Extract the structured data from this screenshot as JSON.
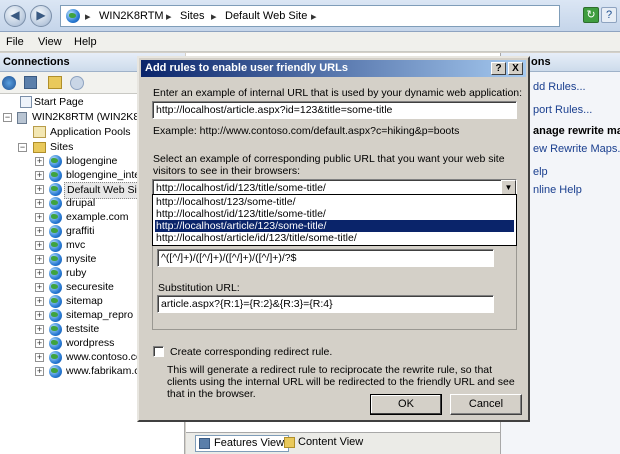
{
  "address": {
    "crumbs": [
      "WIN2K8RTM",
      "Sites",
      "Default Web Site"
    ]
  },
  "menu": [
    "File",
    "View",
    "Help"
  ],
  "connections": {
    "title": "Connections",
    "tree": [
      {
        "label": "Start Page",
        "icon": "start-page-icon"
      },
      {
        "label": "WIN2K8RTM (WIN2K8RTM",
        "icon": "server-icon"
      },
      {
        "label": "Application Pools",
        "icon": "app-pools-icon"
      },
      {
        "label": "Sites",
        "icon": "folder-icon"
      },
      {
        "label": "blogengine",
        "icon": "site-icon"
      },
      {
        "label": "blogengine_integ",
        "icon": "site-icon"
      },
      {
        "label": "Default Web Site",
        "icon": "site-icon"
      },
      {
        "label": "drupal",
        "icon": "site-icon"
      },
      {
        "label": "example.com",
        "icon": "site-icon"
      },
      {
        "label": "graffiti",
        "icon": "site-icon"
      },
      {
        "label": "mvc",
        "icon": "site-icon"
      },
      {
        "label": "mysite",
        "icon": "site-icon"
      },
      {
        "label": "ruby",
        "icon": "site-icon"
      },
      {
        "label": "securesite",
        "icon": "site-icon"
      },
      {
        "label": "sitemap",
        "icon": "site-icon"
      },
      {
        "label": "sitemap_repro",
        "icon": "site-icon"
      },
      {
        "label": "testsite",
        "icon": "site-icon"
      },
      {
        "label": "wordpress",
        "icon": "site-icon"
      },
      {
        "label": "www.contoso.co",
        "icon": "site-icon"
      },
      {
        "label": "www.fabrikam.co",
        "icon": "site-icon"
      }
    ]
  },
  "actions": {
    "header": "ons",
    "items": [
      "dd Rules...",
      "port Rules...",
      "anage rewrite ma",
      "ew Rewrite Maps...",
      "elp",
      "nline Help"
    ]
  },
  "bottom": {
    "features_view": "Features View",
    "content_view": "Content View"
  },
  "dialog": {
    "title": "Add rules to enable user friendly URLs",
    "help_btn": "?",
    "close_btn": "X",
    "internal_label": "Enter an example of internal URL that is used by your dynamic web application:",
    "internal_value": "http://localhost/article.aspx?id=123&title=some-title",
    "example_text": "Example: http://www.contoso.com/default.aspx?c=hiking&p=boots",
    "public_label_1": "Select an example of corresponding public URL that you want your web site",
    "public_label_2": "visitors to see in their browsers:",
    "public_selected": "http://localhost/id/123/title/some-title/",
    "options": [
      "http://localhost/123/some-title/",
      "http://localhost/id/123/title/some-title/",
      "http://localhost/article/123/some-title/",
      "http://localhost/article/id/123/title/some-title/"
    ],
    "selected_option": 2,
    "pattern_value": "^([^/]+)/([^/]+)/([^/]+)/([^/]+)/?$",
    "substitution_label": "Substitution URL:",
    "substitution_value": "article.aspx?{R:1}={R:2}&{R:3}={R:4}",
    "redirect_label": "Create corresponding redirect rule.",
    "redirect_desc_1": "This will generate a redirect rule to reciprocate the rewrite rule, so that",
    "redirect_desc_2": "clients using the internal URL will be redirected to the friendly URL and see",
    "redirect_desc_3": "that in the browser.",
    "ok": "OK",
    "cancel": "Cancel"
  }
}
